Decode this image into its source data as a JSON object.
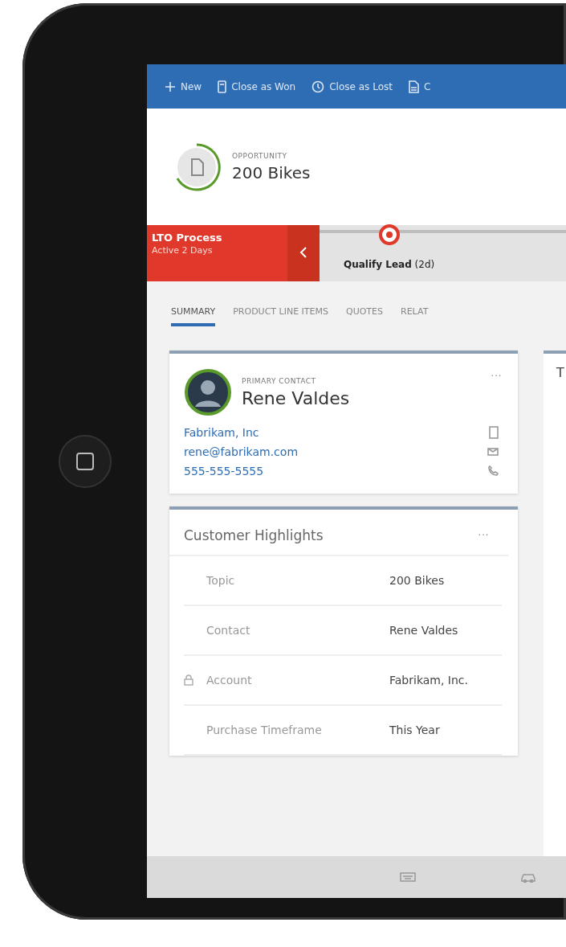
{
  "command_bar": [
    {
      "kind": "new",
      "label": "New"
    },
    {
      "kind": "won",
      "label": "Close as Won"
    },
    {
      "kind": "lost",
      "label": "Close as Lost"
    },
    {
      "kind": "doc",
      "label": "C"
    }
  ],
  "header": {
    "entity": "OPPORTUNITY",
    "title": "200 Bikes"
  },
  "process": {
    "name": "LTO Process",
    "status": "Active 2 Days",
    "stages": [
      {
        "name": "Qualify Lead",
        "duration": "(2d)",
        "selected": true
      }
    ]
  },
  "tabs": [
    {
      "label": "SUMMARY",
      "selected": true
    },
    {
      "label": "PRODUCT LINE ITEMS",
      "selected": false
    },
    {
      "label": "QUOTES",
      "selected": false
    },
    {
      "label": "RELAT",
      "selected": false
    }
  ],
  "contact_card": {
    "caption": "PRIMARY CONTACT",
    "name": "Rene Valdes",
    "more": "···",
    "details": [
      {
        "kind": "account",
        "text": "Fabrikam, Inc"
      },
      {
        "kind": "email",
        "text": "rene@fabrikam.com"
      },
      {
        "kind": "phone",
        "text": "555-555-5555"
      }
    ]
  },
  "highlights": {
    "title": "Customer Highlights",
    "more": "···",
    "rows": [
      {
        "label": "Topic",
        "value": "200 Bikes",
        "locked": false
      },
      {
        "label": "Contact",
        "value": "Rene Valdes",
        "locked": false
      },
      {
        "label": "Account",
        "value": "Fabrikam, Inc.",
        "locked": true
      },
      {
        "label": "Purchase Timeframe",
        "value": "This Year",
        "locked": false
      }
    ]
  },
  "column_2": {
    "title": "T"
  }
}
